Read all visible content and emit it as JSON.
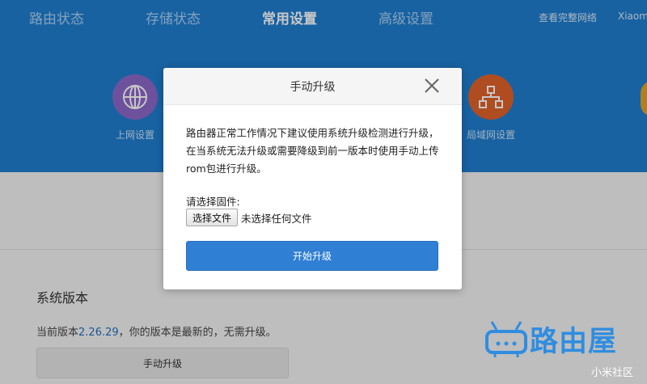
{
  "top_nav": {
    "items": [
      {
        "label": "路由状态",
        "active": false
      },
      {
        "label": "存储状态",
        "active": false
      },
      {
        "label": "常用设置",
        "active": true
      },
      {
        "label": "高级设置",
        "active": false
      }
    ],
    "right_link": "查看完整网络",
    "right_user": "Xiaomi"
  },
  "features": [
    {
      "label": "上网设置",
      "icon": "globe-icon",
      "color": "#8e68c9"
    },
    {
      "label": "局域网设置",
      "icon": "network-icon",
      "color": "#e0622a"
    }
  ],
  "page": {
    "section_title": "系统版本",
    "version_prefix": "当前版本",
    "version": "2.26.29",
    "version_suffix": "，你的版本是最新的，无需升级。",
    "manual_upgrade_button": "手动升级"
  },
  "modal": {
    "title": "手动升级",
    "description": "路由器正常工作情况下建议使用系统升级检测进行升级，在当系统无法升级或需要降级到前一版本时使用手动上传rom包进行升级。",
    "firmware_label": "请选择固件:",
    "choose_file_button": "选择文件",
    "file_status": "未选择任何文件",
    "start_button": "开始升级"
  },
  "watermark": {
    "brand": "路由屋",
    "sub": "小米社区"
  },
  "colors": {
    "header_blue": "#1f7ed0",
    "primary_button": "#2f7fd4",
    "watermark_blue": "#2f8de0"
  }
}
